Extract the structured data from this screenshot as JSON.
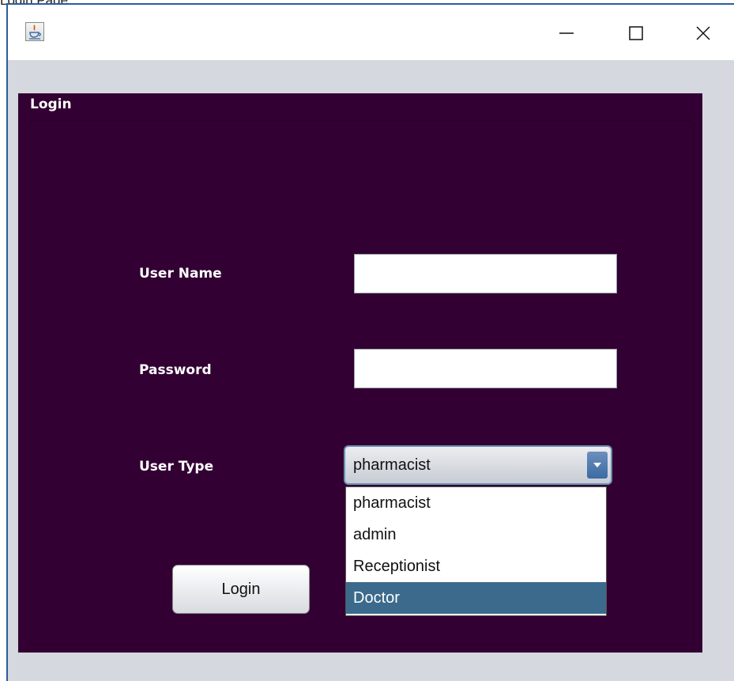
{
  "caption": "Login Page",
  "window": {
    "controls": {
      "minimize": "—",
      "maximize": "☐",
      "close": "✕"
    },
    "icon": "java-app-icon"
  },
  "panel": {
    "title": "Login",
    "background": "#320032"
  },
  "form": {
    "username_label": "User Name",
    "username_value": "",
    "password_label": "Password",
    "password_value": "",
    "user_type_label": "User Type",
    "user_type_selected": "pharmacist",
    "user_type_options": [
      "pharmacist",
      "admin",
      "Receptionist",
      "Doctor"
    ],
    "highlighted_option": "Doctor",
    "login_label": "Login"
  }
}
